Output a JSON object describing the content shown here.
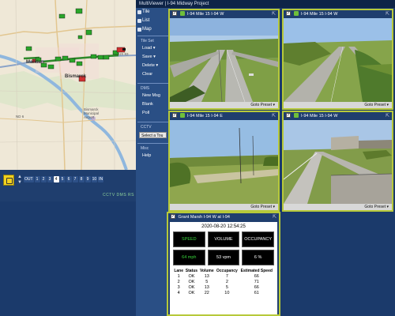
{
  "titlebar": "MultiViewer | I-94 Midway Project",
  "sidemenu": {
    "tile": "Tile",
    "list": "List",
    "map": "Map",
    "tile_set_label": "Tile Set",
    "load": "Load",
    "save": "Save",
    "delete": "Delete",
    "clear": "Clear",
    "dms_label": "DMS",
    "new_msg": "New Msg",
    "blank": "Blank",
    "poll": "Poll",
    "cctv_label": "CCTV",
    "cctv_select": "Select a Tou",
    "misc_label": "Misc",
    "help": "Help"
  },
  "map": {
    "city_mandan": "Mandan",
    "city_bismarck": "Bismarck",
    "label_us83": "US 83",
    "label_nd6": "ND 6",
    "label_ostroot": "Bismarck Municipal Airport"
  },
  "zoombar": {
    "levels": [
      "OUT",
      "1",
      "2",
      "3",
      "4",
      "5",
      "6",
      "7",
      "8",
      "9",
      "10",
      "IN"
    ],
    "active_level": "4",
    "label": "CCTV DMS RS"
  },
  "cameras": [
    {
      "title": "I-94 Mile 15  I-94 W",
      "preset": "Goto Preset"
    },
    {
      "title": "I-94 Mile 15  I-94 W",
      "preset": "Goto Preset"
    },
    {
      "title": "I-94 Mile 15  I-94 E",
      "preset": "Goto Preset"
    },
    {
      "title": "I-94 Mile 15  I-94 W",
      "preset": "Goto Preset"
    }
  ],
  "traffic": {
    "title": "Grant Marsh  I-94 W at I-94",
    "timestamp": "2020-08-20 12:54:25",
    "headers": [
      "SPEED",
      "VOLUME",
      "OCCUPANCY"
    ],
    "values": [
      "64 mph",
      "53 vpm",
      "6 %"
    ],
    "lane_headers": [
      "Lane",
      "Status",
      "Volume",
      "Occupancy",
      "Estimated Speed"
    ],
    "lanes": [
      [
        "1",
        "OK",
        "13",
        "7",
        "66"
      ],
      [
        "2",
        "OK",
        "5",
        "2",
        "71"
      ],
      [
        "3",
        "OK",
        "13",
        "5",
        "66"
      ],
      [
        "4",
        "OK",
        "22",
        "10",
        "61"
      ]
    ]
  },
  "colors": {
    "background": "#1b3a6b",
    "panel_border": "#b7c93a",
    "speed_green": "#39d53c"
  }
}
